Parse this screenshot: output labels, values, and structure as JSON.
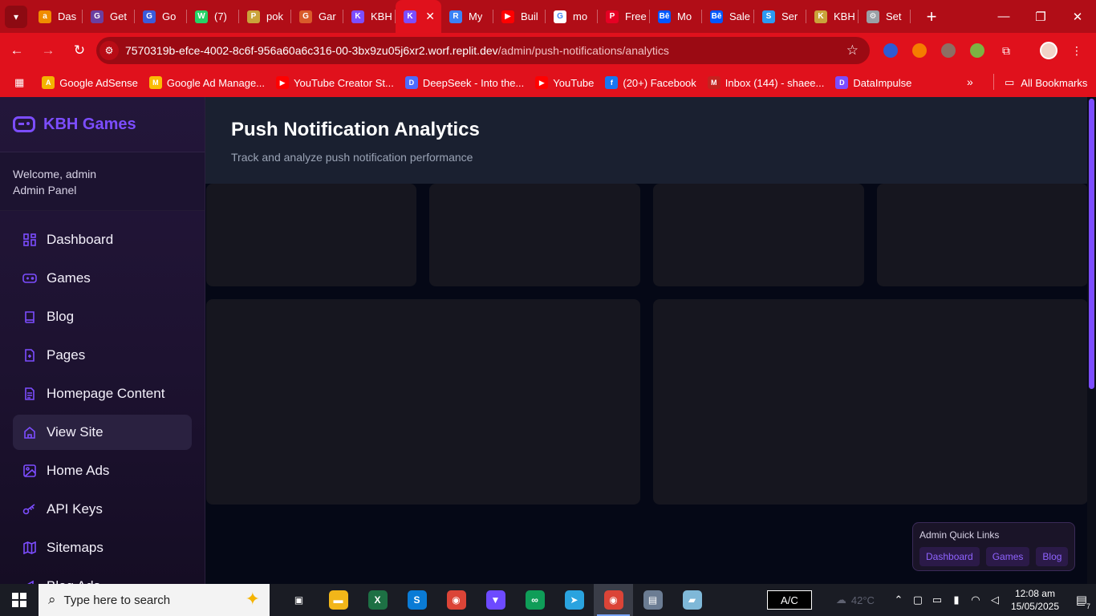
{
  "browser": {
    "tabs": [
      {
        "title": "Das",
        "icon": "amazon-icon",
        "color": "#f08c00",
        "glyph": "a"
      },
      {
        "title": "Get",
        "icon": "gamepad-icon",
        "color": "#6b3fa0",
        "glyph": "G"
      },
      {
        "title": "Go",
        "icon": "shield-icon",
        "color": "#3b5bdb",
        "glyph": "G"
      },
      {
        "title": "(7)",
        "icon": "whatsapp-icon",
        "color": "#25d366",
        "glyph": "W"
      },
      {
        "title": "pok",
        "icon": "pokemon-icon",
        "color": "#caa33a",
        "glyph": "P"
      },
      {
        "title": "Gar",
        "icon": "gartner-icon",
        "color": "#d95b2a",
        "glyph": "G"
      },
      {
        "title": "KBH",
        "icon": "gamepad-icon",
        "color": "#7c4dff",
        "glyph": "K"
      },
      {
        "title": "",
        "icon": "gamepad-icon",
        "color": "#7c4dff",
        "glyph": "K",
        "active": true
      },
      {
        "title": "My",
        "icon": "replit-icon",
        "color": "#3b82f6",
        "glyph": "R"
      },
      {
        "title": "Buil",
        "icon": "youtube-icon",
        "color": "#ff0000",
        "glyph": "▶"
      },
      {
        "title": "mo",
        "icon": "google-icon",
        "color": "#ffffff",
        "glyph": "G"
      },
      {
        "title": "Free",
        "icon": "pinterest-icon",
        "color": "#e60023",
        "glyph": "P"
      },
      {
        "title": "Mo",
        "icon": "behance-icon",
        "color": "#0057ff",
        "glyph": "Bē"
      },
      {
        "title": "Sale",
        "icon": "behance-icon",
        "color": "#0057ff",
        "glyph": "Bē"
      },
      {
        "title": "Ser",
        "icon": "puzzle-icon",
        "color": "#2b9af3",
        "glyph": "S"
      },
      {
        "title": "KBH",
        "icon": "pokemon-icon",
        "color": "#caa33a",
        "glyph": "K"
      },
      {
        "title": "Set",
        "icon": "gear-icon",
        "color": "#9aa0a6",
        "glyph": "⚙"
      }
    ],
    "url_host": "7570319b-efce-4002-8c6f-956a60a6c316-00-3bx9zu05j6xr2.worf.replit.dev",
    "url_path": "/admin/push-notifications/analytics",
    "bookmarks": [
      {
        "label": "Google AdSense",
        "icon": "adsense-icon",
        "color": "#f4b400",
        "glyph": "A"
      },
      {
        "label": "Google Ad Manage...",
        "icon": "admanager-icon",
        "color": "#fbbc04",
        "glyph": "M"
      },
      {
        "label": "YouTube Creator St...",
        "icon": "youtube-icon",
        "color": "#ff0000",
        "glyph": "▶"
      },
      {
        "label": "DeepSeek - Into the...",
        "icon": "deepseek-icon",
        "color": "#4d6bfe",
        "glyph": "D"
      },
      {
        "label": "YouTube",
        "icon": "youtube-icon",
        "color": "#ff0000",
        "glyph": "▶"
      },
      {
        "label": "(20+) Facebook",
        "icon": "facebook-icon",
        "color": "#1877f2",
        "glyph": "f"
      },
      {
        "label": "Inbox (144) - shaee...",
        "icon": "gmail-icon",
        "color": "#c5221f",
        "glyph": "M"
      },
      {
        "label": "DataImpulse",
        "icon": "dataimpulse-icon",
        "color": "#7c4dff",
        "glyph": "D"
      }
    ],
    "all_bookmarks": "All Bookmarks",
    "accent": "#e0111c"
  },
  "sidebar": {
    "brand": "KBH Games",
    "welcome": "Welcome, admin",
    "role": "Admin Panel",
    "items": [
      {
        "label": "Dashboard",
        "icon": "dashboard-icon"
      },
      {
        "label": "Games",
        "icon": "gamepad-icon"
      },
      {
        "label": "Blog",
        "icon": "book-icon"
      },
      {
        "label": "Pages",
        "icon": "file-icon"
      },
      {
        "label": "Homepage Content",
        "icon": "document-icon"
      },
      {
        "label": "View Site",
        "icon": "home-icon"
      },
      {
        "label": "Home Ads",
        "icon": "image-icon"
      },
      {
        "label": "API Keys",
        "icon": "key-icon"
      },
      {
        "label": "Sitemaps",
        "icon": "map-icon"
      },
      {
        "label": "Blog Ads",
        "icon": "megaphone-icon"
      }
    ]
  },
  "page": {
    "title": "Push Notification Analytics",
    "subtitle": "Track and analyze push notification performance"
  },
  "quick_links": {
    "title": "Admin Quick Links",
    "links": [
      "Dashboard",
      "Games",
      "Blog"
    ]
  },
  "taskbar": {
    "search_placeholder": "Type here to search",
    "apps": [
      {
        "name": "task-view-icon",
        "color": "#1a1c24",
        "glyph": "▣"
      },
      {
        "name": "file-explorer-icon",
        "color": "#f2b619",
        "glyph": "▬"
      },
      {
        "name": "excel-icon",
        "color": "#1d7044",
        "glyph": "X"
      },
      {
        "name": "skype-icon",
        "color": "#0a7bd6",
        "glyph": "S"
      },
      {
        "name": "chrome-icon",
        "color": "#db4437",
        "glyph": "◉"
      },
      {
        "name": "proton-vpn-icon",
        "color": "#6d4aff",
        "glyph": "▼"
      },
      {
        "name": "gameloop-icon",
        "color": "#0f9d58",
        "glyph": "∞"
      },
      {
        "name": "telegram-icon",
        "color": "#2aa3df",
        "glyph": "➤"
      },
      {
        "name": "chrome-icon",
        "color": "#db4437",
        "glyph": "◉",
        "active": true
      },
      {
        "name": "photos-icon",
        "color": "#6b7c93",
        "glyph": "▤"
      },
      {
        "name": "sticky-notes-icon",
        "color": "#7fb8d8",
        "glyph": "▰"
      }
    ],
    "ac_label": "A/C",
    "weather": "42°C",
    "time": "12:08 am",
    "date": "15/05/2025",
    "notification_count": "7"
  }
}
